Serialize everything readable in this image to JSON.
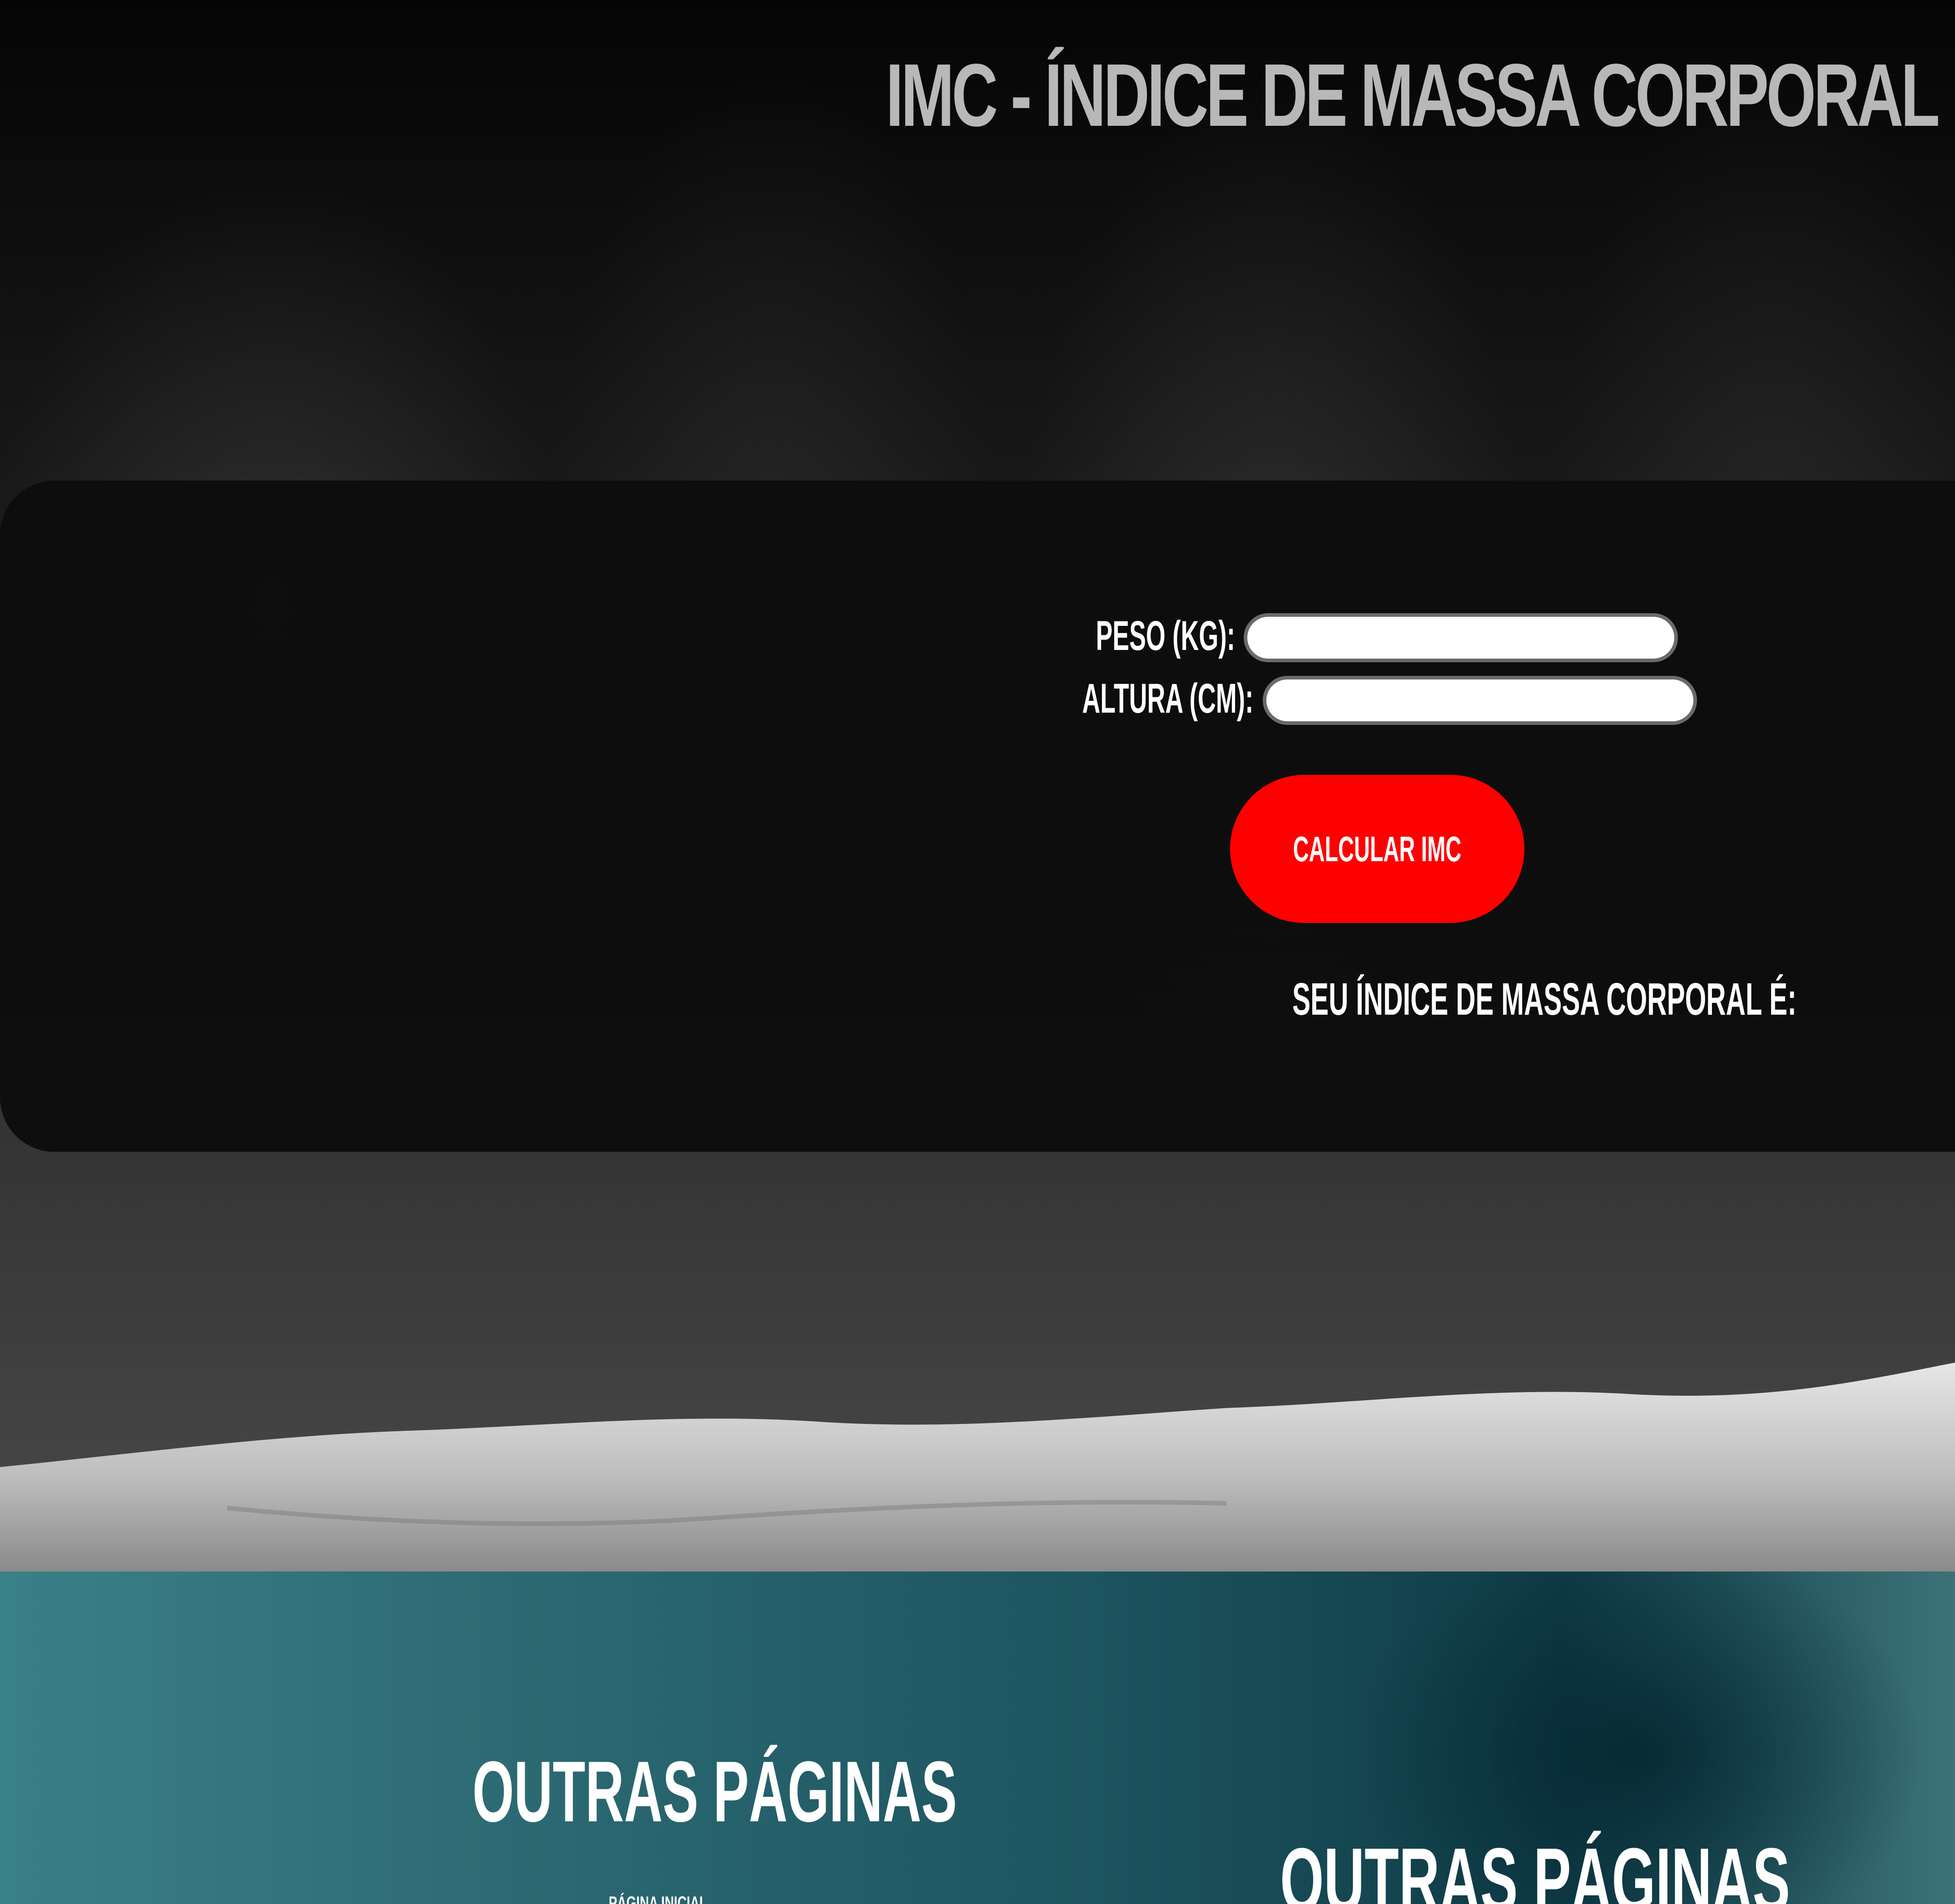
{
  "header": {
    "title": "IMC - ÍNDICE DE MASSA CORPORAL"
  },
  "form": {
    "weight_label": "PESO (KG):",
    "weight_value": "",
    "height_label": "ALTURA (CM):",
    "height_value": "",
    "submit_label": "CALCULAR IMC",
    "result_label": "SEU ÍNDICE DE MASSA CORPORAL É:"
  },
  "footer": {
    "heading_left": "OUTRAS PÁGINAS",
    "heading_right": "OUTRAS PÁGINAS",
    "link_first": "PÁGINA INICIAL"
  },
  "colors": {
    "title": "#b8b8b8",
    "button": "#ff0000",
    "footer_teal": "#2d6b74"
  }
}
